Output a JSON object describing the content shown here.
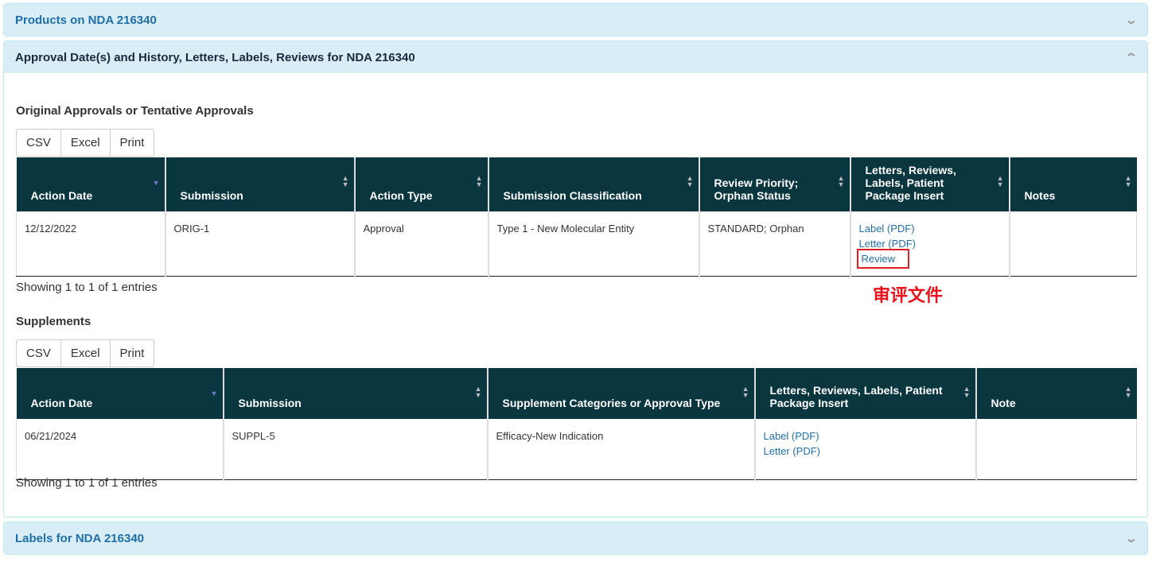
{
  "panels": {
    "products": "Products on NDA 216340",
    "approval": "Approval Date(s) and History, Letters, Labels, Reviews for NDA 216340",
    "labels": "Labels for NDA 216340"
  },
  "original": {
    "title": "Original Approvals or Tentative Approvals",
    "buttons": [
      "CSV",
      "Excel",
      "Print"
    ],
    "headers": [
      "Action Date",
      "Submission",
      "Action Type",
      "Submission Classification",
      "Review Priority; Orphan Status",
      "Letters, Reviews, Labels, Patient Package Insert",
      "Notes"
    ],
    "row": {
      "date": "12/12/2022",
      "submission": "ORIG-1",
      "action_type": "Approval",
      "classification": "Type 1 - New Molecular Entity",
      "priority": "STANDARD; Orphan",
      "links": [
        "Label (PDF)",
        "Letter (PDF)",
        "Review"
      ],
      "notes": ""
    },
    "info": "Showing 1 to 1 of 1 entries"
  },
  "annotation": "审评文件",
  "supplements": {
    "title": "Supplements",
    "buttons": [
      "CSV",
      "Excel",
      "Print"
    ],
    "headers": [
      "Action Date",
      "Submission",
      "Supplement Categories or Approval Type",
      "Letters, Reviews, Labels, Patient Package Insert",
      "Note"
    ],
    "row": {
      "date": "06/21/2024",
      "submission": "SUPPL-5",
      "category": "Efficacy-New Indication",
      "links": [
        "Label (PDF)",
        "Letter (PDF)"
      ],
      "note": ""
    },
    "info": "Showing 1 to 1 of 1 entries"
  }
}
